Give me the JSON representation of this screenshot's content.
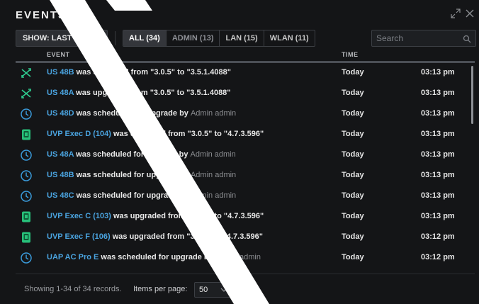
{
  "window": {
    "title": "EVENTS",
    "icons": [
      "expand-icon",
      "close-icon"
    ]
  },
  "toolbar": {
    "show_label": "SHOW: LAST HOUR",
    "filters": [
      {
        "label": "ALL (34)",
        "active": true
      },
      {
        "label": "ADMIN (13)",
        "active": false
      },
      {
        "label": "LAN (15)",
        "active": false
      },
      {
        "label": "WLAN (11)",
        "active": false
      }
    ],
    "search_placeholder": "Search"
  },
  "table": {
    "col_event": "EVENT",
    "col_time": "TIME",
    "rows": [
      {
        "icon": "upgrade-icon",
        "device": "US 48B",
        "text": " was upgraded from ",
        "from": "\"3.0.5\"",
        "mid": " to ",
        "to": "\"3.5.1.4088\"",
        "date": "Today",
        "time": "03:13 pm"
      },
      {
        "icon": "upgrade-icon",
        "device": "US 48A",
        "text": " was upgraded from ",
        "from": "\"3.0.5\"",
        "mid": " to ",
        "to": "\"3.5.1.4088\"",
        "date": "Today",
        "time": "03:13 pm"
      },
      {
        "icon": "clock-icon",
        "device": "US 48D",
        "text": " was scheduled for upgrade by ",
        "admin": "Admin admin",
        "date": "Today",
        "time": "03:13 pm"
      },
      {
        "icon": "ap-device-icon",
        "device": "UVP Exec D (104)",
        "text": " was upgraded from ",
        "from": "\"3.0.5\"",
        "mid": " to ",
        "to": "\"4.7.3.596\"",
        "date": "Today",
        "time": "03:13 pm"
      },
      {
        "icon": "clock-icon",
        "device": "US 48A",
        "text": " was scheduled for upgrade by ",
        "admin": "Admin admin",
        "date": "Today",
        "time": "03:13 pm"
      },
      {
        "icon": "clock-icon",
        "device": "US 48B",
        "text": " was scheduled for upgrade by ",
        "admin": "Admin admin",
        "date": "Today",
        "time": "03:13 pm"
      },
      {
        "icon": "clock-icon",
        "device": "US 48C",
        "text": " was scheduled for upgrade by ",
        "admin": "Admin admin",
        "date": "Today",
        "time": "03:13 pm"
      },
      {
        "icon": "ap-device-icon",
        "device": "UVP Exec C (103)",
        "text": " was upgraded from ",
        "from": "\"3.0.5\"",
        "mid": " to ",
        "to": "\"4.7.3.596\"",
        "date": "Today",
        "time": "03:13 pm"
      },
      {
        "icon": "ap-device-icon",
        "device": "UVP Exec F (106)",
        "text": " was upgraded from ",
        "from": "\"3.0.5\"",
        "mid": " to ",
        "to": "\"4.7.3.596\"",
        "date": "Today",
        "time": "03:12 pm"
      },
      {
        "icon": "clock-icon",
        "device": "UAP AC Pro E",
        "text": " was scheduled for upgrade by ",
        "admin": "Admin admin",
        "date": "Today",
        "time": "03:12 pm"
      }
    ]
  },
  "footer": {
    "records": "Showing 1-34 of 34 records.",
    "items_per_page_label": "Items per page:",
    "items_per_page_value": "50"
  },
  "colors": {
    "device_link": "#4aa3df",
    "upgrade_icon": "#2ecc8f",
    "clock_icon": "#3a9ad9",
    "ap_icon": "#27c07a"
  }
}
